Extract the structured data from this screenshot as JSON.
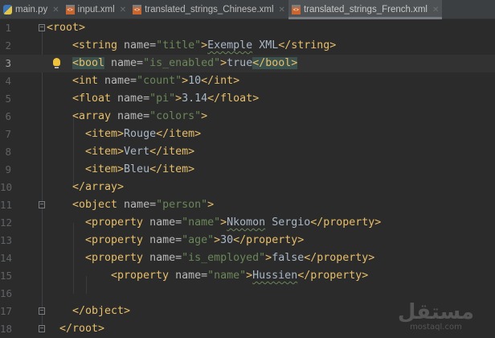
{
  "tabs": [
    {
      "label": "main.py",
      "type": "py",
      "active": false
    },
    {
      "label": "input.xml",
      "type": "xml",
      "active": false
    },
    {
      "label": "translated_strings_Chinese.xml",
      "type": "xml",
      "active": false
    },
    {
      "label": "translated_strings_French.xml",
      "type": "xml",
      "active": true
    }
  ],
  "editor": {
    "current_line": 3,
    "lines": [
      {
        "n": "1",
        "indent": 0,
        "parts": [
          [
            "t",
            "<root>"
          ]
        ]
      },
      {
        "n": "2",
        "indent": 4,
        "parts": [
          [
            "t",
            "<string "
          ],
          [
            "a",
            "name="
          ],
          [
            "v",
            "\"title\""
          ],
          [
            "t",
            ">"
          ],
          [
            "x sq",
            "Exemple"
          ],
          [
            "x",
            " XML"
          ],
          [
            "t",
            "</string>"
          ]
        ]
      },
      {
        "n": "3",
        "indent": 4,
        "parts": [
          [
            "t hl",
            "<bool"
          ],
          [
            "a",
            " name="
          ],
          [
            "v",
            "\"is_enabled\""
          ],
          [
            "t",
            ">"
          ],
          [
            "x",
            "true"
          ],
          [
            "t hl",
            "</bool>"
          ]
        ]
      },
      {
        "n": "4",
        "indent": 4,
        "parts": [
          [
            "t",
            "<int "
          ],
          [
            "a",
            "name="
          ],
          [
            "v",
            "\"count\""
          ],
          [
            "t",
            ">"
          ],
          [
            "x",
            "10"
          ],
          [
            "t",
            "</int>"
          ]
        ]
      },
      {
        "n": "5",
        "indent": 4,
        "parts": [
          [
            "t",
            "<float "
          ],
          [
            "a",
            "name="
          ],
          [
            "v",
            "\"pi\""
          ],
          [
            "t",
            ">"
          ],
          [
            "x",
            "3.14"
          ],
          [
            "t",
            "</float>"
          ]
        ]
      },
      {
        "n": "6",
        "indent": 4,
        "parts": [
          [
            "t",
            "<array "
          ],
          [
            "a",
            "name="
          ],
          [
            "v",
            "\"colors\""
          ],
          [
            "t",
            ">"
          ]
        ]
      },
      {
        "n": "7",
        "indent": 6,
        "parts": [
          [
            "t",
            "<item>"
          ],
          [
            "x",
            "Rouge"
          ],
          [
            "t",
            "</item>"
          ]
        ]
      },
      {
        "n": "8",
        "indent": 6,
        "parts": [
          [
            "t",
            "<item>"
          ],
          [
            "x",
            "Vert"
          ],
          [
            "t",
            "</item>"
          ]
        ]
      },
      {
        "n": "9",
        "indent": 6,
        "parts": [
          [
            "t",
            "<item>"
          ],
          [
            "x",
            "Bleu"
          ],
          [
            "t",
            "</item>"
          ]
        ]
      },
      {
        "n": "10",
        "indent": 4,
        "parts": [
          [
            "t",
            "</array>"
          ]
        ]
      },
      {
        "n": "11",
        "indent": 4,
        "parts": [
          [
            "t",
            "<object "
          ],
          [
            "a",
            "name="
          ],
          [
            "v",
            "\"person\""
          ],
          [
            "t",
            ">"
          ]
        ]
      },
      {
        "n": "12",
        "indent": 6,
        "parts": [
          [
            "t",
            "<property "
          ],
          [
            "a",
            "name="
          ],
          [
            "v",
            "\"name\""
          ],
          [
            "t",
            ">"
          ],
          [
            "x sq",
            "Nkomon"
          ],
          [
            "x",
            " Sergio"
          ],
          [
            "t",
            "</property>"
          ]
        ]
      },
      {
        "n": "13",
        "indent": 6,
        "parts": [
          [
            "t",
            "<property "
          ],
          [
            "a",
            "name="
          ],
          [
            "v",
            "\"age\""
          ],
          [
            "t",
            ">"
          ],
          [
            "x",
            "30"
          ],
          [
            "t",
            "</property>"
          ]
        ]
      },
      {
        "n": "14",
        "indent": 6,
        "parts": [
          [
            "t",
            "<property "
          ],
          [
            "a",
            "name="
          ],
          [
            "v",
            "\"is_employed\""
          ],
          [
            "t",
            ">"
          ],
          [
            "x",
            "false"
          ],
          [
            "t",
            "</property>"
          ]
        ]
      },
      {
        "n": "15",
        "indent": 10,
        "parts": [
          [
            "t",
            "<property "
          ],
          [
            "a",
            "name="
          ],
          [
            "v",
            "\"name\""
          ],
          [
            "t",
            ">"
          ],
          [
            "x sq",
            "Hussien"
          ],
          [
            "t",
            "</property>"
          ]
        ]
      },
      {
        "n": "16",
        "indent": 0,
        "parts": []
      },
      {
        "n": "17",
        "indent": 4,
        "parts": [
          [
            "t",
            "</object>"
          ]
        ]
      },
      {
        "n": "18",
        "indent": 2,
        "parts": [
          [
            "t",
            "</root>"
          ]
        ]
      }
    ]
  },
  "watermark": {
    "arabic": "مستقل",
    "latin": "mostaql.com"
  },
  "colors": {
    "background": "#2b2b2b",
    "tag": "#e8bf6a",
    "attribute": "#bababa",
    "value": "#6a8759",
    "text": "#a9b7c6",
    "tab_bar": "#3c3f41"
  }
}
